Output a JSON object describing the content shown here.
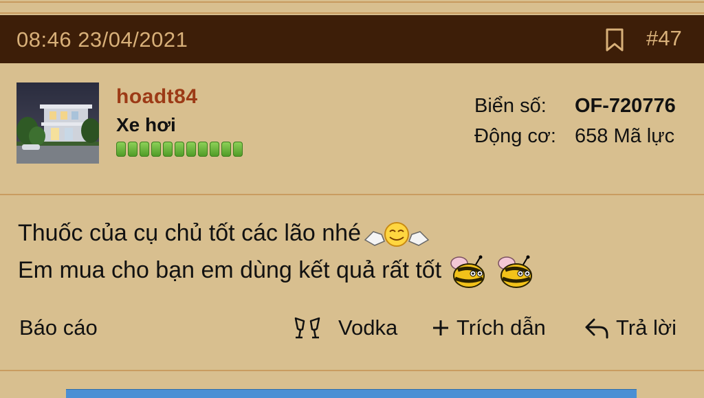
{
  "post": {
    "timestamp": "08:46 23/04/2021",
    "number": "#47"
  },
  "user": {
    "name": "hoadt84",
    "title": "Xe hơi",
    "reputation_pips": 11,
    "plate_label": "Biển số:",
    "plate_value": "OF-720776",
    "engine_label": "Động cơ:",
    "engine_value": "658 Mã lực"
  },
  "message": {
    "line1": "Thuốc của cụ chủ tốt các lão nhé",
    "line2": "Em mua cho bạn em dùng kết quả rất tốt",
    "emoji1": "clapping-smiley-icon",
    "emoji2": "bee-icon"
  },
  "actions": {
    "report": "Báo cáo",
    "vodka": "Vodka",
    "quote": "Trích dẫn",
    "reply": "Trả lời"
  },
  "colors": {
    "background": "#d8bf8f",
    "header_bg": "#3d1e08",
    "header_text": "#d8b079",
    "username": "#9c3a16"
  }
}
